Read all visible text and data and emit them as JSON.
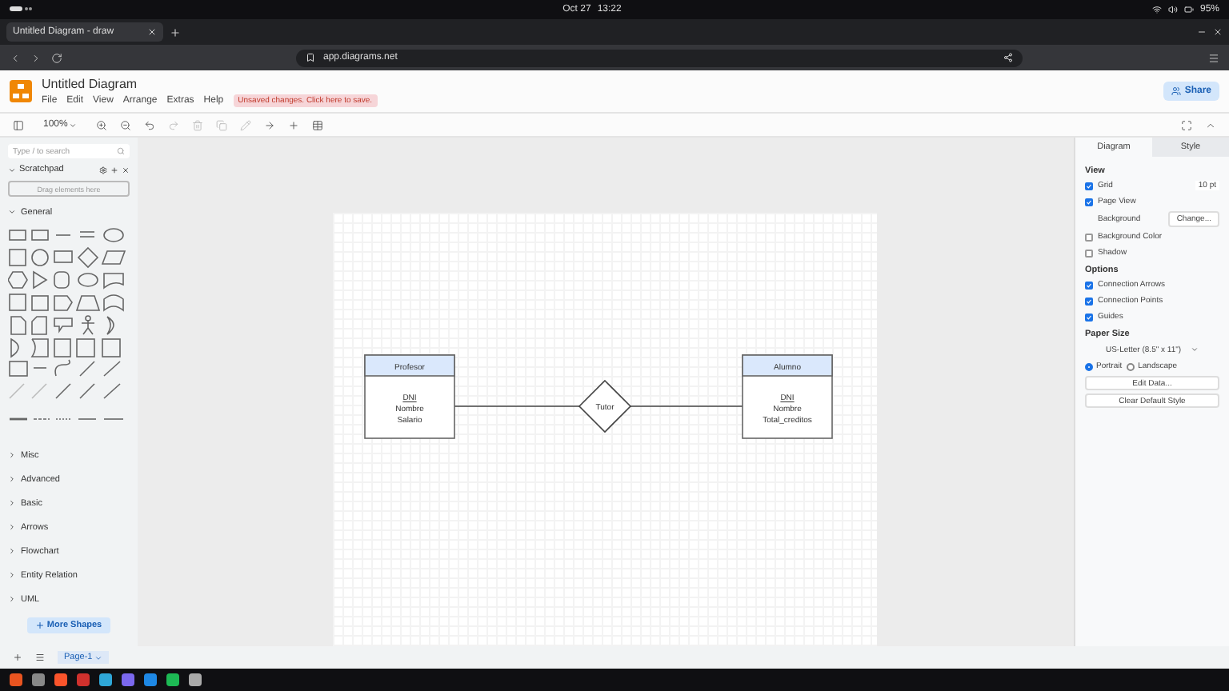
{
  "system_bar": {
    "date": "Oct 27",
    "time": "13:22",
    "battery": "95%"
  },
  "browser": {
    "tab_title": "Untitled Diagram - draw",
    "address": "app.diagrams.net"
  },
  "app": {
    "title": "Untitled Diagram",
    "menu": [
      "File",
      "Edit",
      "View",
      "Arrange",
      "Extras",
      "Help"
    ],
    "notice": "Unsaved changes. Click here to save.",
    "share": "Share"
  },
  "toolbar": {
    "zoom": "100%"
  },
  "sidebar": {
    "search_placeholder": "Type / to search",
    "scratchpad": "Scratchpad",
    "drop_hint": "Drag elements here",
    "sections": [
      {
        "label": "General",
        "expanded": true
      },
      {
        "label": "Misc",
        "expanded": false
      },
      {
        "label": "Advanced",
        "expanded": false
      },
      {
        "label": "Basic",
        "expanded": false
      },
      {
        "label": "Arrows",
        "expanded": false
      },
      {
        "label": "Flowchart",
        "expanded": false
      },
      {
        "label": "Entity Relation",
        "expanded": false
      },
      {
        "label": "UML",
        "expanded": false
      }
    ],
    "more_shapes": "More Shapes"
  },
  "diagram": {
    "entities": [
      {
        "name": "Profesor",
        "attributes": [
          {
            "text": "DNI",
            "key": true
          },
          {
            "text": "Nombre",
            "key": false
          },
          {
            "text": "Salario",
            "key": false
          }
        ]
      },
      {
        "name": "Alumno",
        "attributes": [
          {
            "text": "DNI",
            "key": true
          },
          {
            "text": "Nombre",
            "key": false
          },
          {
            "text": "Total_creditos",
            "key": false
          }
        ]
      }
    ],
    "relationship": "Tutor"
  },
  "format_panel": {
    "tabs": [
      {
        "label": "Diagram",
        "selected": true
      },
      {
        "label": "Style",
        "selected": false
      }
    ],
    "view_heading": "View",
    "view": [
      {
        "kind": "checkbox",
        "label": "Grid",
        "checked": true,
        "value": "10 pt"
      },
      {
        "kind": "checkbox",
        "label": "Page View",
        "checked": true
      },
      {
        "kind": "background",
        "label": "Background",
        "button": "Change..."
      },
      {
        "kind": "checkbox",
        "label": "Background Color",
        "checked": false
      },
      {
        "kind": "checkbox",
        "label": "Shadow",
        "checked": false
      }
    ],
    "options_heading": "Options",
    "options": [
      {
        "label": "Connection Arrows",
        "checked": true
      },
      {
        "label": "Connection Points",
        "checked": true
      },
      {
        "label": "Guides",
        "checked": true
      }
    ],
    "paper_heading": "Paper Size",
    "paper_size": "US-Letter (8.5\" x 11\")",
    "orientation": [
      {
        "label": "Portrait",
        "selected": true
      },
      {
        "label": "Landscape",
        "selected": false
      }
    ],
    "buttons": [
      "Edit Data...",
      "Clear Default Style"
    ]
  },
  "pages": [
    {
      "label": "Page-1",
      "selected": true
    }
  ]
}
